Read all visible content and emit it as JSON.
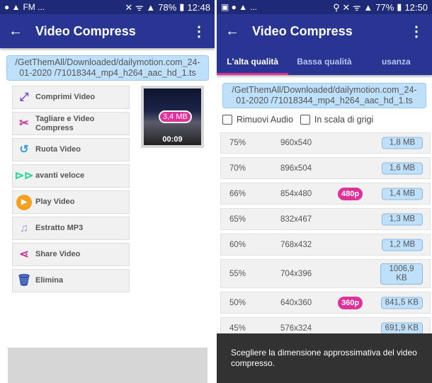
{
  "left": {
    "status": {
      "notif": "FM ...",
      "battery": "78%",
      "time": "12:48"
    },
    "appbar": {
      "title": "Video Compress"
    },
    "path": "/GetThemAll/Downloaded/dailymotion.com_24-01-2020 /71018344_mp4_h264_aac_hd_1.ts",
    "buttons": [
      {
        "label": "Comprimi Video",
        "icon": "compress-icon",
        "color": "#7b3fd0"
      },
      {
        "label": "Tagliare e Video Compress",
        "icon": "cut-compress-icon",
        "color": "#d0309a"
      },
      {
        "label": "Ruota Video",
        "icon": "rotate-icon",
        "color": "#3b9be0"
      },
      {
        "label": "avanti veloce",
        "icon": "fast-forward-icon",
        "color": "#2ed39a"
      },
      {
        "label": "Play Video",
        "icon": "play-icon",
        "color": "#f5a020"
      },
      {
        "label": "Estratto MP3",
        "icon": "mp3-file-icon",
        "color": "#a58fd8"
      },
      {
        "label": "Share Video",
        "icon": "share-icon",
        "color": "#d0309a"
      },
      {
        "label": "Elimina",
        "icon": "trash-icon",
        "color": "#2e4fb0"
      }
    ],
    "thumbnail": {
      "size": "3,4 MB",
      "duration": "00:09"
    }
  },
  "right": {
    "status": {
      "notif": "...",
      "battery": "77%",
      "time": "12:50"
    },
    "appbar": {
      "title": "Video Compress"
    },
    "tabs": [
      "L'alta qualità",
      "Bassa qualità",
      "usanza"
    ],
    "active_tab": 0,
    "path": "/GetThemAll/Downloaded/dailymotion.com_24-01-2020 /71018344_mp4_h264_aac_hd_1.ts",
    "checkboxes": [
      {
        "label": "Rimuovi Audio",
        "checked": false
      },
      {
        "label": "In scala di grigi",
        "checked": false
      }
    ],
    "rows": [
      {
        "pct": "75%",
        "res": "960x540",
        "badge": "",
        "size": "1,8 MB"
      },
      {
        "pct": "70%",
        "res": "896x504",
        "badge": "",
        "size": "1,6 MB"
      },
      {
        "pct": "66%",
        "res": "854x480",
        "badge": "480p",
        "size": "1,4 MB"
      },
      {
        "pct": "65%",
        "res": "832x467",
        "badge": "",
        "size": "1,3 MB"
      },
      {
        "pct": "60%",
        "res": "768x432",
        "badge": "",
        "size": "1,2 MB"
      },
      {
        "pct": "55%",
        "res": "704x396",
        "badge": "",
        "size": "1006,9 KB"
      },
      {
        "pct": "50%",
        "res": "640x360",
        "badge": "360p",
        "size": "841,5 KB"
      },
      {
        "pct": "45%",
        "res": "576x324",
        "badge": "",
        "size": "691,9 KB"
      }
    ],
    "snackbar": "Scegliere la dimensione approssimativa del video compresso."
  },
  "colors": {
    "primary": "#283593",
    "status": "#1e2a78",
    "accent": "#e0309a",
    "chip": "#bfe0fb"
  }
}
